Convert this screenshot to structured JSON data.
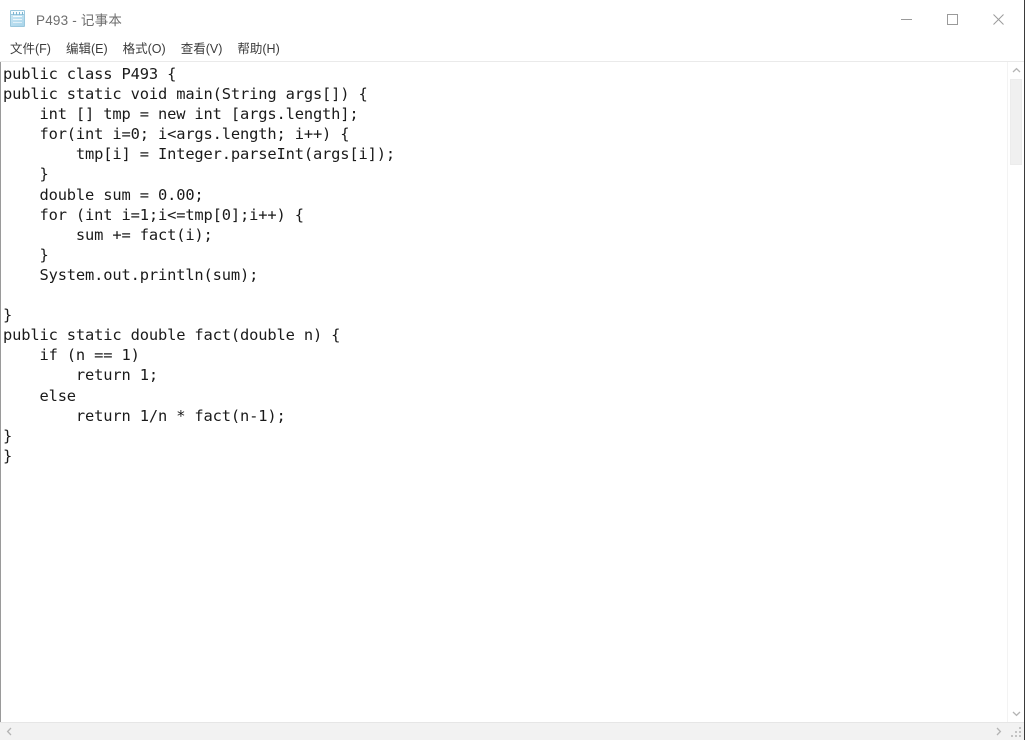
{
  "window": {
    "title": "P493 - 记事本",
    "app_icon": "notepad-icon",
    "controls": {
      "minimize": "minimize-icon",
      "maximize": "maximize-icon",
      "close": "close-icon"
    }
  },
  "menubar": {
    "items": [
      {
        "label": "文件(F)"
      },
      {
        "label": "编辑(E)"
      },
      {
        "label": "格式(O)"
      },
      {
        "label": "查看(V)"
      },
      {
        "label": "帮助(H)"
      }
    ]
  },
  "editor": {
    "content": "public class P493 {\npublic static void main(String args[]) {\n    int [] tmp = new int [args.length];\n    for(int i=0; i<args.length; i++) {\n        tmp[i] = Integer.parseInt(args[i]);\n    }\n    double sum = 0.00;\n    for (int i=1;i<=tmp[0];i++) {\n        sum += fact(i);\n    }\n    System.out.println(sum);\n\n}\npublic static double fact(double n) {\n    if (n == 1)\n        return 1;\n    else\n        return 1/n * fact(n-1);\n}\n}",
    "lines": [
      "public class P493 {",
      "public static void main(String args[]) {",
      "    int [] tmp = new int [args.length];",
      "    for(int i=0; i<args.length; i++) {",
      "        tmp[i] = Integer.parseInt(args[i]);",
      "    }",
      "    double sum = 0.00;",
      "    for (int i=1;i<=tmp[0];i++) {",
      "        sum += fact(i);",
      "    }",
      "    System.out.println(sum);",
      "",
      "}",
      "public static double fact(double n) {",
      "    if (n == 1)",
      "        return 1;",
      "    else",
      "        return 1/n * fact(n-1);",
      "}",
      "}"
    ]
  },
  "scrollbars": {
    "vertical": {
      "up_arrow": "chevron-up-icon",
      "down_arrow": "chevron-down-icon"
    },
    "horizontal": {
      "left_arrow": "chevron-left-icon",
      "right_arrow": "chevron-right-icon"
    },
    "resize_grip": "resize-grip-icon"
  },
  "colors": {
    "window_background": "#ffffff",
    "text": "#1a1a1a",
    "title_text": "#6e6e6e",
    "menu_text": "#3b3b3b",
    "scrollbar_track": "#f2f2f2",
    "scrollbar_thumb": "#f0f0f0"
  }
}
